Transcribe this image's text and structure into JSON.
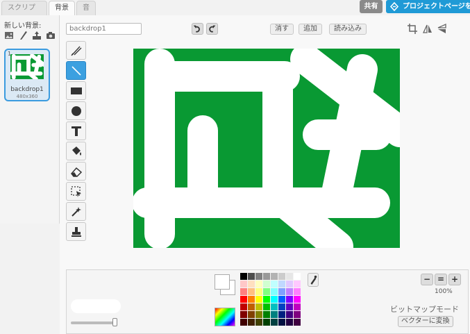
{
  "tabs": [
    {
      "label": "スクリプト",
      "active": false
    },
    {
      "label": "背景",
      "active": true
    },
    {
      "label": "音",
      "active": false
    }
  ],
  "header": {
    "share_label": "共有",
    "project_label": "プロジェクトページを見る"
  },
  "backdrops": {
    "new_label": "新しい背景:",
    "items": [
      {
        "number": "1",
        "name": "backdrop1",
        "size": "480x360"
      }
    ]
  },
  "editor": {
    "name_value": "backdrop1",
    "clear_label": "消す",
    "add_label": "追加",
    "import_label": "読み込み"
  },
  "tools": [
    {
      "name": "brush-tool",
      "icon": "brush-icon",
      "selected": false
    },
    {
      "name": "line-tool",
      "icon": "line-icon",
      "selected": true
    },
    {
      "name": "rectangle-tool",
      "icon": "rectangle-icon",
      "selected": false
    },
    {
      "name": "ellipse-tool",
      "icon": "ellipse-icon",
      "selected": false
    },
    {
      "name": "text-tool",
      "icon": "text-icon",
      "selected": false
    },
    {
      "name": "fill-tool",
      "icon": "paint-bucket-icon",
      "selected": false
    },
    {
      "name": "eraser-tool",
      "icon": "eraser-icon",
      "selected": false
    },
    {
      "name": "select-tool",
      "icon": "select-icon",
      "selected": false
    },
    {
      "name": "magic-select-tool",
      "icon": "magic-wand-icon",
      "selected": false
    },
    {
      "name": "stamp-tool",
      "icon": "stamp-icon",
      "selected": false
    }
  ],
  "canvas": {
    "background_color": "#099933",
    "stroke_color": "#ffffff"
  },
  "colors": {
    "accent_blue": "#1f9ad6",
    "selected_tool": "#3ca0e0",
    "palette": [
      "#000000",
      "#4d4d4d",
      "#808080",
      "#999999",
      "#b3b3b3",
      "#cccccc",
      "#e6e6e6",
      "#ffffff",
      "#ffc8c8",
      "#ffe0c0",
      "#ffffc0",
      "#d0ffd0",
      "#c0ffff",
      "#c0d8ff",
      "#e0c8ff",
      "#ffc8ff",
      "#ff8080",
      "#ffc080",
      "#ffff80",
      "#80ff80",
      "#80ffff",
      "#80a0ff",
      "#c080ff",
      "#ff80ff",
      "#ff0000",
      "#ff8000",
      "#ffff00",
      "#00ff00",
      "#00ffff",
      "#0060ff",
      "#8000ff",
      "#ff00ff",
      "#c00000",
      "#c06000",
      "#c0c000",
      "#00c000",
      "#00c0c0",
      "#0040c0",
      "#6000c0",
      "#c000c0",
      "#800000",
      "#804000",
      "#808000",
      "#008000",
      "#008080",
      "#002080",
      "#400080",
      "#800080",
      "#400000",
      "#402000",
      "#404000",
      "#004000",
      "#004040",
      "#001040",
      "#200040",
      "#400040"
    ]
  },
  "zoom": {
    "out_symbol": "−",
    "reset_symbol": "=",
    "in_symbol": "+",
    "level": "100%"
  },
  "mode": {
    "label": "ビットマップモード",
    "convert_label": "ベクターに変換"
  }
}
